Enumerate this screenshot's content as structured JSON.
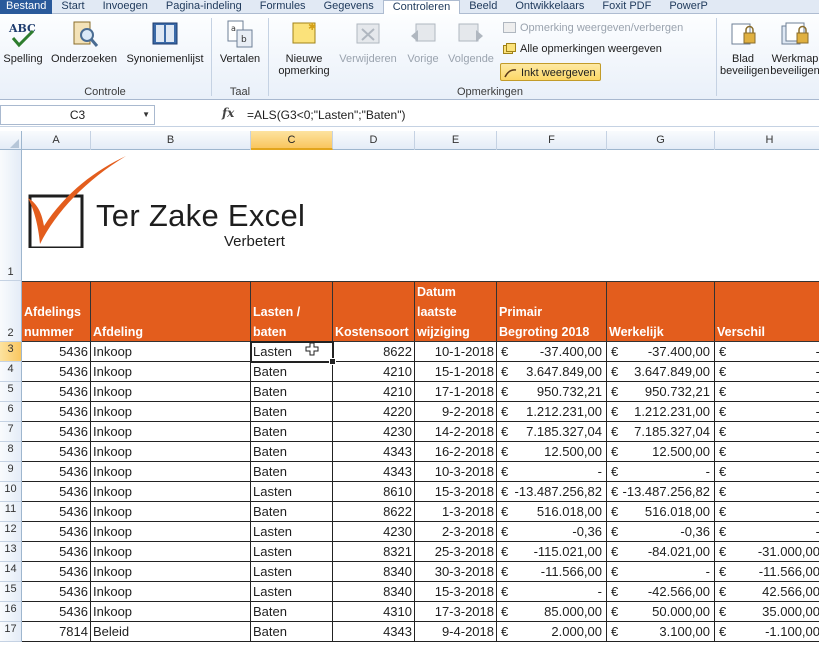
{
  "ribbon_tabs": [
    "Bestand",
    "Start",
    "Invoegen",
    "Pagina-indeling",
    "Formules",
    "Gegevens",
    "Controleren",
    "Beeld",
    "Ontwikkelaars",
    "Foxit PDF",
    "PowerP"
  ],
  "active_tab": "Controleren",
  "ribbon": {
    "spelling": "Spelling",
    "onderzoeken": "Onderzoeken",
    "synoniemenlijst": "Synoniemenlijst",
    "group_controle": "Controle",
    "vertalen": "Vertalen",
    "group_taal": "Taal",
    "nieuwe_opmerking_1": "Nieuwe",
    "nieuwe_opmerking_2": "opmerking",
    "verwijderen": "Verwijderen",
    "vorige": "Vorige",
    "volgende": "Volgende",
    "opmerking_weergeven": "Opmerking weergeven/verbergen",
    "alle_opmerkingen": "Alle opmerkingen weergeven",
    "inkt_weergeven": "Inkt weergeven",
    "group_opmerkingen": "Opmerkingen",
    "blad_beveiligen_1": "Blad",
    "blad_beveiligen_2": "beveiligen",
    "werkmap_beveiligen_1": "Werkmap",
    "werkmap_beveiligen_2": "beveiligen"
  },
  "formula_bar": {
    "name_box": "C3",
    "fx": "fx",
    "formula": "=ALS(G3<0;\"Lasten\";\"Baten\")"
  },
  "columns": [
    "A",
    "B",
    "C",
    "D",
    "E",
    "F",
    "G",
    "H"
  ],
  "selected_column": "C",
  "logo": {
    "title": "Ter Zake Excel",
    "subtitle": "Verbetert"
  },
  "header": {
    "afdelingsnummer": [
      "Afdelings",
      "nummer"
    ],
    "afdeling": [
      "Afdeling"
    ],
    "lasten_baten": [
      "Lasten /",
      "baten"
    ],
    "kostensoort": [
      "Kostensoort"
    ],
    "datum": [
      "Datum",
      "laatste",
      "wijziging"
    ],
    "begroting": [
      "Primair",
      "Begroting 2018"
    ],
    "werkelijk": [
      "Werkelijk"
    ],
    "verschil": [
      "Verschil"
    ]
  },
  "currency": "€",
  "rows": [
    {
      "row": "3",
      "nr": "5436",
      "afd": "Inkoop",
      "lb": "Lasten",
      "ks": "8622",
      "datum": "10-1-2018",
      "beg": "-37.400,00",
      "werk": "-37.400,00",
      "vers": "-"
    },
    {
      "row": "4",
      "nr": "5436",
      "afd": "Inkoop",
      "lb": "Baten",
      "ks": "4210",
      "datum": "15-1-2018",
      "beg": "3.647.849,00",
      "werk": "3.647.849,00",
      "vers": "-"
    },
    {
      "row": "5",
      "nr": "5436",
      "afd": "Inkoop",
      "lb": "Baten",
      "ks": "4210",
      "datum": "17-1-2018",
      "beg": "950.732,21",
      "werk": "950.732,21",
      "vers": "-"
    },
    {
      "row": "6",
      "nr": "5436",
      "afd": "Inkoop",
      "lb": "Baten",
      "ks": "4220",
      "datum": "9-2-2018",
      "beg": "1.212.231,00",
      "werk": "1.212.231,00",
      "vers": "-"
    },
    {
      "row": "7",
      "nr": "5436",
      "afd": "Inkoop",
      "lb": "Baten",
      "ks": "4230",
      "datum": "14-2-2018",
      "beg": "7.185.327,04",
      "werk": "7.185.327,04",
      "vers": "-"
    },
    {
      "row": "8",
      "nr": "5436",
      "afd": "Inkoop",
      "lb": "Baten",
      "ks": "4343",
      "datum": "16-2-2018",
      "beg": "12.500,00",
      "werk": "12.500,00",
      "vers": "-"
    },
    {
      "row": "9",
      "nr": "5436",
      "afd": "Inkoop",
      "lb": "Baten",
      "ks": "4343",
      "datum": "10-3-2018",
      "beg": "-",
      "werk": "-",
      "vers": "-"
    },
    {
      "row": "10",
      "nr": "5436",
      "afd": "Inkoop",
      "lb": "Lasten",
      "ks": "8610",
      "datum": "15-3-2018",
      "beg": "-13.487.256,82",
      "werk": "-13.487.256,82",
      "vers": "-"
    },
    {
      "row": "11",
      "nr": "5436",
      "afd": "Inkoop",
      "lb": "Baten",
      "ks": "8622",
      "datum": "1-3-2018",
      "beg": "516.018,00",
      "werk": "516.018,00",
      "vers": "-"
    },
    {
      "row": "12",
      "nr": "5436",
      "afd": "Inkoop",
      "lb": "Lasten",
      "ks": "4230",
      "datum": "2-3-2018",
      "beg": "-0,36",
      "werk": "-0,36",
      "vers": "-"
    },
    {
      "row": "13",
      "nr": "5436",
      "afd": "Inkoop",
      "lb": "Lasten",
      "ks": "8321",
      "datum": "25-3-2018",
      "beg": "-115.021,00",
      "werk": "-84.021,00",
      "vers": "-31.000,00"
    },
    {
      "row": "14",
      "nr": "5436",
      "afd": "Inkoop",
      "lb": "Lasten",
      "ks": "8340",
      "datum": "30-3-2018",
      "beg": "-11.566,00",
      "werk": "-",
      "vers": "-11.566,00"
    },
    {
      "row": "15",
      "nr": "5436",
      "afd": "Inkoop",
      "lb": "Lasten",
      "ks": "8340",
      "datum": "15-3-2018",
      "beg": "-",
      "werk": "-42.566,00",
      "vers": "42.566,00"
    },
    {
      "row": "16",
      "nr": "5436",
      "afd": "Inkoop",
      "lb": "Baten",
      "ks": "4310",
      "datum": "17-3-2018",
      "beg": "85.000,00",
      "werk": "50.000,00",
      "vers": "35.000,00"
    },
    {
      "row": "17",
      "nr": "7814",
      "afd": "Beleid",
      "lb": "Baten",
      "ks": "4343",
      "datum": "9-4-2018",
      "beg": "2.000,00",
      "werk": "3.100,00",
      "vers": "-1.100,00"
    }
  ],
  "row_labels_top": [
    "1",
    "2"
  ],
  "colors": {
    "header_orange": "#e35d1d",
    "logo_orange": "#e35d1d",
    "tab_file": "#2a5a9b"
  }
}
